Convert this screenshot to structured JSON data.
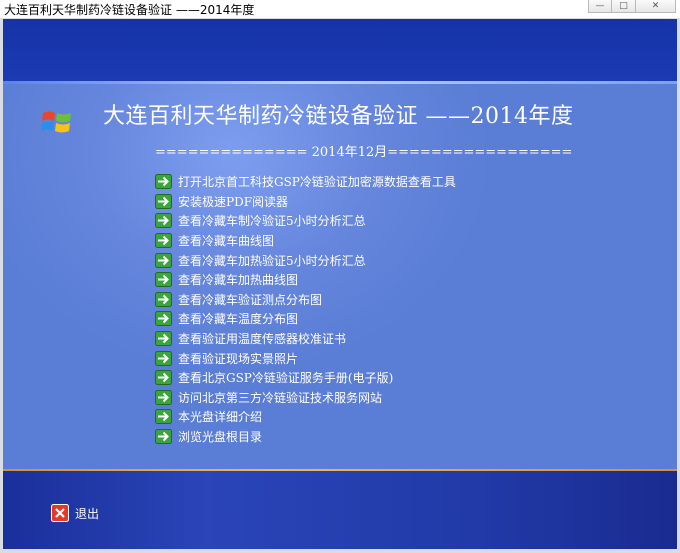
{
  "window": {
    "title": "大连百利天华制药冷链设备验证 ——2014年度",
    "minimize_glyph": "—",
    "maximize_glyph": "□",
    "close_glyph": "✕"
  },
  "header": {
    "logo_icon": "windows-logo-icon",
    "title": "大连百利天华制药冷链设备验证 ——2014年度",
    "subtitle": "============== 2014年12月================="
  },
  "menu": {
    "items": [
      {
        "label": "打开北京首工科技GSP冷链验证加密源数据查看工具",
        "icon": "green-arrow-icon"
      },
      {
        "label": "安装极速PDF阅读器",
        "icon": "green-arrow-icon"
      },
      {
        "label": "查看冷藏车制冷验证5小时分析汇总",
        "icon": "green-arrow-icon"
      },
      {
        "label": "查看冷藏车曲线图",
        "icon": "green-arrow-icon"
      },
      {
        "label": "查看冷藏车加热验证5小时分析汇总",
        "icon": "green-arrow-icon"
      },
      {
        "label": "查看冷藏车加热曲线图",
        "icon": "green-arrow-icon"
      },
      {
        "label": "查看冷藏车验证测点分布图",
        "icon": "green-arrow-icon"
      },
      {
        "label": "查看冷藏车温度分布图",
        "icon": "green-arrow-icon"
      },
      {
        "label": "查看验证用温度传感器校准证书",
        "icon": "green-arrow-icon"
      },
      {
        "label": "查看验证现场实景照片",
        "icon": "green-arrow-icon"
      },
      {
        "label": "查看北京GSP冷链验证服务手册(电子版)",
        "icon": "green-arrow-icon"
      },
      {
        "label": "访问北京第三方冷链验证技术服务网站",
        "icon": "green-arrow-icon"
      },
      {
        "label": "本光盘详细介绍",
        "icon": "green-arrow-icon"
      },
      {
        "label": "浏览光盘根目录",
        "icon": "green-arrow-icon"
      }
    ]
  },
  "footer": {
    "exit_label": "退出",
    "exit_icon": "red-x-icon"
  },
  "colors": {
    "top_band": "#1632a6",
    "content_bg": "#5b7fd3",
    "bottom_band": "#213aa8",
    "accent_line": "#f4b45a",
    "arrow_green": "#3aa53a",
    "text": "#ffffff"
  }
}
